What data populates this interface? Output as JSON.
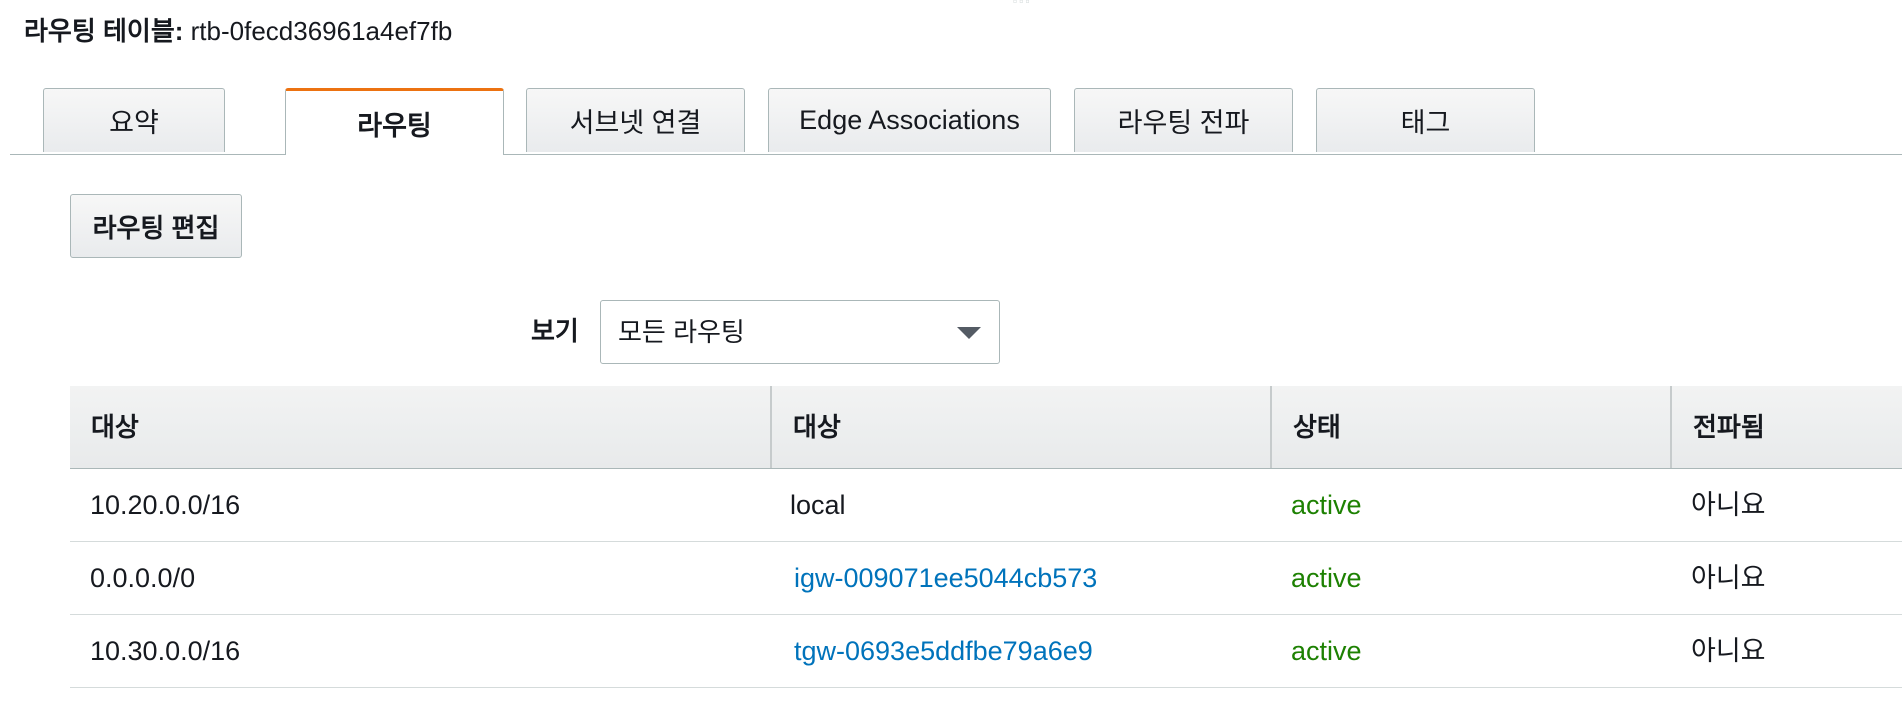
{
  "heading": {
    "label": "라우팅 테이블:",
    "value": "rtb-0fecd36961a4ef7fb"
  },
  "tabs": [
    {
      "label": "요약",
      "active": false
    },
    {
      "label": "라우팅",
      "active": true
    },
    {
      "label": "서브넷 연결",
      "active": false
    },
    {
      "label": "Edge Associations",
      "active": false
    },
    {
      "label": "라우팅 전파",
      "active": false
    },
    {
      "label": "태그",
      "active": false
    }
  ],
  "edit_button": {
    "label": "라우팅 편집"
  },
  "view_filter": {
    "label": "보기",
    "selected": "모든 라우팅"
  },
  "table": {
    "columns": [
      "대상",
      "대상",
      "상태",
      "전파됨"
    ],
    "rows": [
      {
        "destination": "10.20.0.0/16",
        "target": "local",
        "target_is_link": false,
        "status": "active",
        "propagated": "아니요"
      },
      {
        "destination": "0.0.0.0/0",
        "target": "igw-009071ee5044cb573",
        "target_is_link": true,
        "status": "active",
        "propagated": "아니요"
      },
      {
        "destination": "10.30.0.0/16",
        "target": "tgw-0693e5ddfbe79a6e9",
        "target_is_link": true,
        "status": "active",
        "propagated": "아니요"
      }
    ]
  },
  "colors": {
    "accent": "#ec7211",
    "link": "#0073bb",
    "status_active": "#1d8102"
  },
  "icons": {
    "drag_handle": "drag-handle-icon",
    "caret": "caret-down-icon"
  }
}
